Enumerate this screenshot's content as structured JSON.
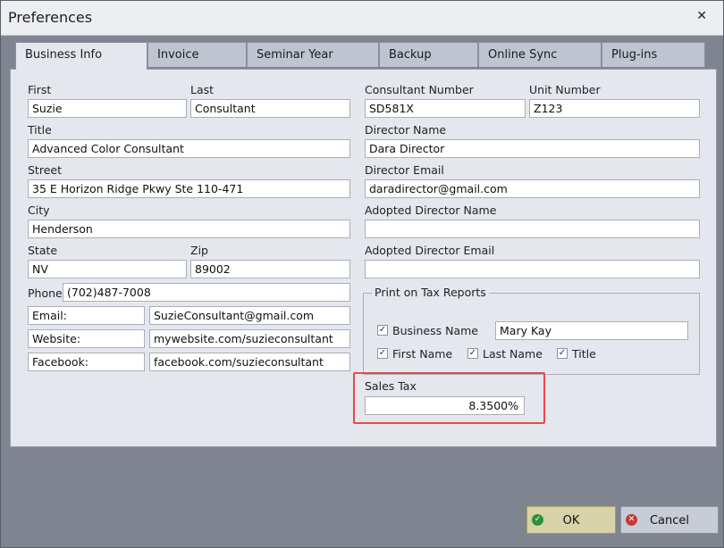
{
  "window": {
    "title": "Preferences"
  },
  "tabs": [
    "Business Info",
    "Invoice",
    "Seminar Year",
    "Backup",
    "Online Sync",
    "Plug-ins"
  ],
  "form": {
    "first_label": "First",
    "first_value": "Suzie",
    "last_label": "Last",
    "last_value": "Consultant",
    "title_label": "Title",
    "title_value": "Advanced Color Consultant",
    "street_label": "Street",
    "street_value": "35 E Horizon Ridge Pkwy Ste 110-471",
    "city_label": "City",
    "city_value": "Henderson",
    "state_label": "State",
    "state_value": "NV",
    "zip_label": "Zip",
    "zip_value": "89002",
    "phone_label": "Phone",
    "phone_value": "(702)487-7008",
    "email_label": "Email:",
    "email_value": "SuzieConsultant@gmail.com",
    "website_label": "Website:",
    "website_value": "mywebsite.com/suzieconsultant",
    "facebook_label": "Facebook:",
    "facebook_value": "facebook.com/suzieconsultant",
    "consultant_number_label": "Consultant Number",
    "consultant_number_value": "SD581X",
    "unit_number_label": "Unit Number",
    "unit_number_value": "Z123",
    "director_name_label": "Director Name",
    "director_name_value": "Dara Director",
    "director_email_label": "Director Email",
    "director_email_value": "daradirector@gmail.com",
    "adopted_director_name_label": "Adopted Director Name",
    "adopted_director_name_value": "",
    "adopted_director_email_label": "Adopted Director Email",
    "adopted_director_email_value": ""
  },
  "tax_reports": {
    "title": "Print on Tax Reports",
    "business_name_label": "Business Name",
    "business_name_value": "Mary Kay",
    "business_name_checked": true,
    "first_name_label": "First Name",
    "first_name_checked": true,
    "last_name_label": "Last Name",
    "last_name_checked": true,
    "title_label": "Title",
    "title_checked": true
  },
  "sales_tax": {
    "label": "Sales Tax",
    "value": "8.3500%"
  },
  "buttons": {
    "ok_label": "OK",
    "cancel_label": "Cancel"
  },
  "colors": {
    "highlight": "#e84a4a",
    "ok_bg": "#d7d3a8",
    "ok_icon": "#2f8f3a",
    "cancel_icon": "#c23b3b"
  },
  "icons": {
    "ok": "check-circle-icon",
    "cancel": "x-circle-icon",
    "close": "close-icon",
    "checkbox": "checkmark-icon"
  }
}
